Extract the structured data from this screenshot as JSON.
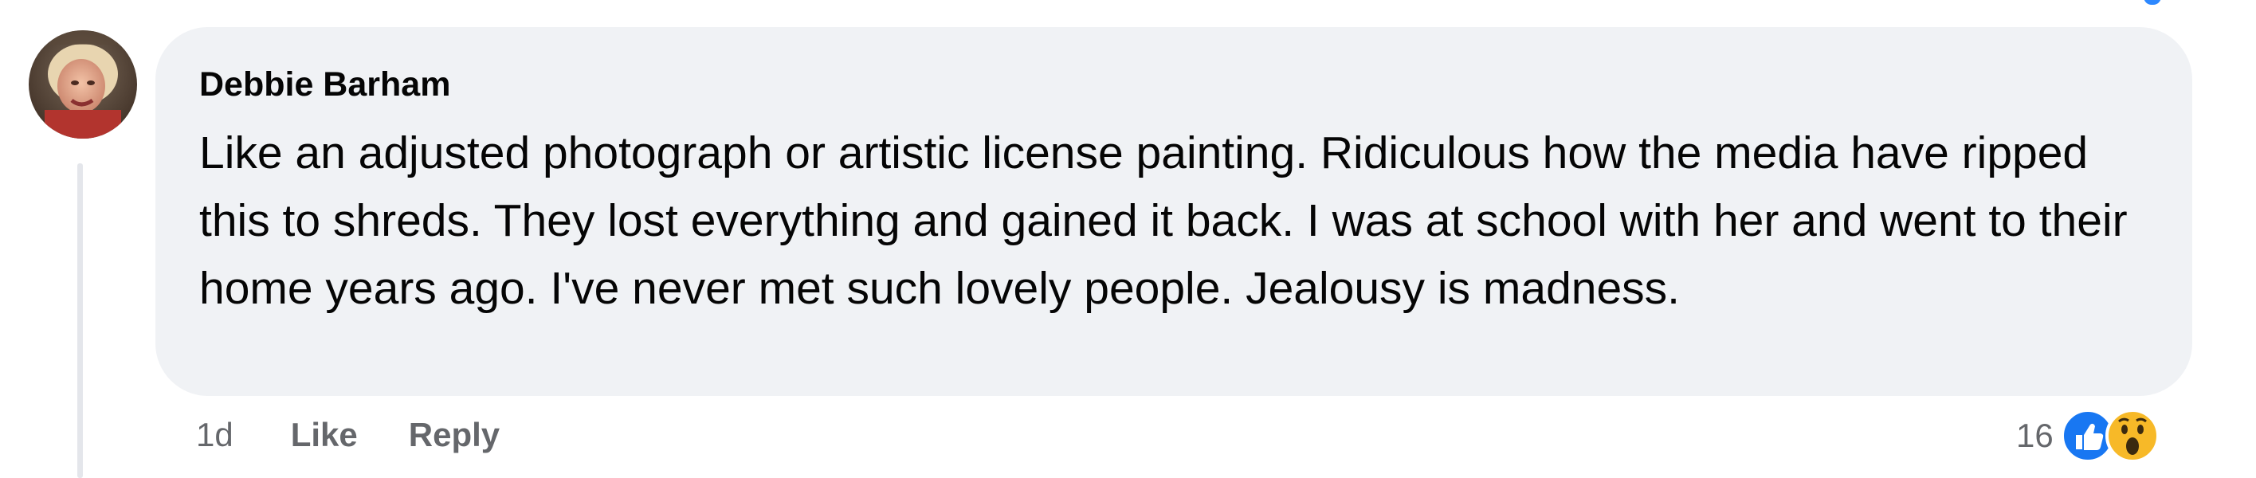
{
  "comment": {
    "author": "Debbie Barham",
    "text": "Like an adjusted photograph or artistic license painting. Ridiculous how the media have ripped this to shreds. They lost everything and gained it back. I was at school with her and went to their home years ago. I've never met such lovely people. Jealousy is madness.",
    "timestamp": "1d",
    "like_label": "Like",
    "reply_label": "Reply",
    "reaction_count": "16",
    "reactions": [
      "like-icon",
      "wow-icon"
    ]
  },
  "colors": {
    "bubble_bg": "#f0f2f5",
    "text": "#050505",
    "meta_text": "#65676b",
    "like_blue": "#1877f2",
    "wow_yellow": "#f7b928",
    "thread_line": "#e4e6eb"
  }
}
